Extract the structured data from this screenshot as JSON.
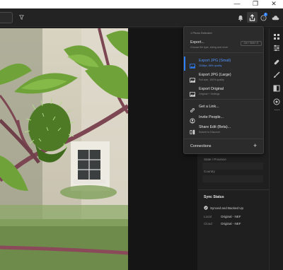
{
  "window": {
    "minimize_glyph": "—",
    "maximize_glyph": "❐",
    "close_glyph": "✕"
  },
  "toolbar": {
    "icons": [
      "search-icon",
      "filter-icon",
      "bell-icon",
      "share-icon",
      "help-icon",
      "cloud-icon"
    ],
    "notification_badge": "1"
  },
  "export_menu": {
    "header": "1 Photo Selected",
    "export": {
      "title": "Export...",
      "subtitle": "Choose file type, sizing and more",
      "shortcut": "Ctrl + Shift + E"
    },
    "presets": [
      {
        "title": "Export JPG (Small)",
        "subtitle": "2048px, 85% quality",
        "selected": true
      },
      {
        "title": "Export JPG (Large)",
        "subtitle": "Full size, 100% quality",
        "selected": false
      },
      {
        "title": "Export Original",
        "subtitle": "Original + Settings",
        "selected": false
      }
    ],
    "share": [
      {
        "title": "Get a Link...",
        "subtitle": ""
      },
      {
        "title": "Invite People...",
        "subtitle": ""
      },
      {
        "title": "Share Edit (Beta)...",
        "subtitle": "Submit to Discover"
      }
    ],
    "connections": {
      "label": "Connections",
      "add_glyph": "+"
    }
  },
  "info_panel": {
    "state_province_label": "State / Province",
    "country_label": "Country",
    "sync": {
      "title": "Sync Status",
      "status": "Synced and Backed Up",
      "local_label": "Local",
      "local_value": "Original - NEF",
      "cloud_label": "Cloud",
      "cloud_value": "Original - NEF"
    }
  },
  "right_rail": {
    "icons": [
      "grid-icon",
      "sliders-icon",
      "bandage-icon",
      "brush-icon",
      "presets-icon",
      "radial-filter-icon",
      "more-icon"
    ]
  },
  "colors": {
    "accent": "#2d7ff9",
    "menu_bg": "#2b2b2b",
    "app_bg": "#1e1e1e"
  }
}
